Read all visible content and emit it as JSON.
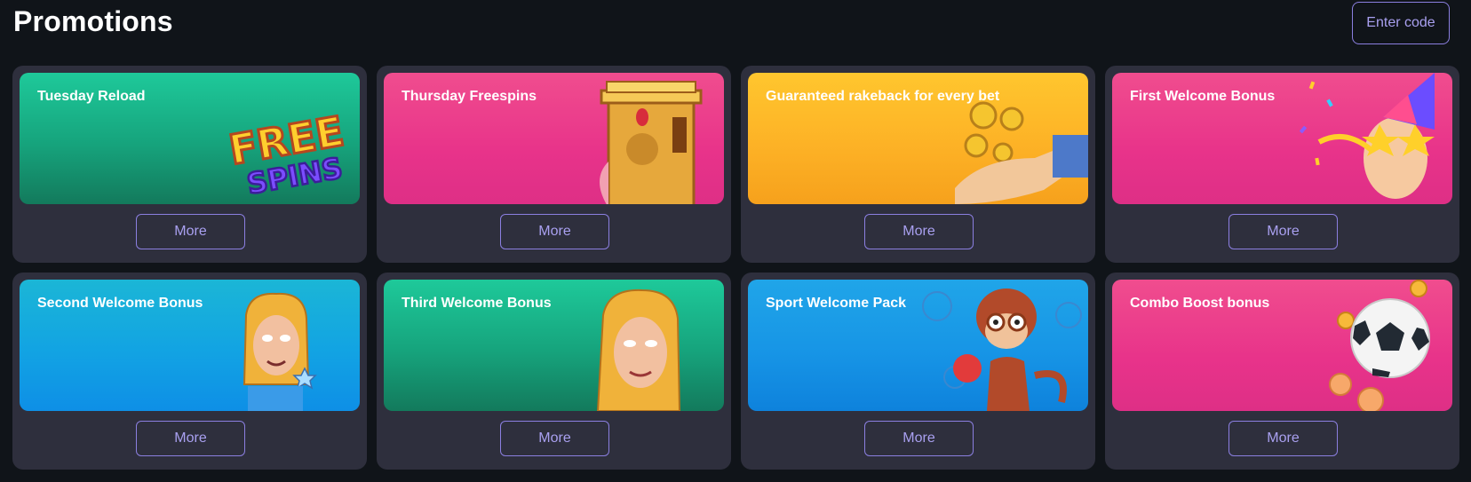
{
  "header": {
    "title": "Promotions",
    "enter_code_label": "Enter code"
  },
  "promotions": [
    {
      "title": "Tuesday Reload",
      "more_label": "More",
      "art": "free-spins-art"
    },
    {
      "title": "Thursday Freespins",
      "more_label": "More",
      "art": "egyptian-pillar-art"
    },
    {
      "title": "Guaranteed rakeback for every bet",
      "more_label": "More",
      "art": "coins-hand-art"
    },
    {
      "title": "First Welcome Bonus",
      "more_label": "More",
      "art": "party-character-art"
    },
    {
      "title": "Second Welcome Bonus",
      "more_label": "More",
      "art": "character-cyan-art"
    },
    {
      "title": "Third Welcome Bonus",
      "more_label": "More",
      "art": "character-green-art"
    },
    {
      "title": "Sport Welcome Pack",
      "more_label": "More",
      "art": "boxing-monkey-art"
    },
    {
      "title": "Combo Boost bonus",
      "more_label": "More",
      "art": "soccer-ball-art"
    }
  ],
  "art_text": {
    "free": "FREE",
    "spins": "SPINS"
  },
  "colors": {
    "background": "#101419",
    "card": "#2e2f3d",
    "accent_border": "#8b7fe0",
    "accent_text": "#a9a0f0",
    "green": "#1ec99a",
    "pink": "#f04d8e",
    "yellow": "#ffc62e",
    "cyan": "#1bb6d6",
    "blue": "#20a5e8"
  }
}
